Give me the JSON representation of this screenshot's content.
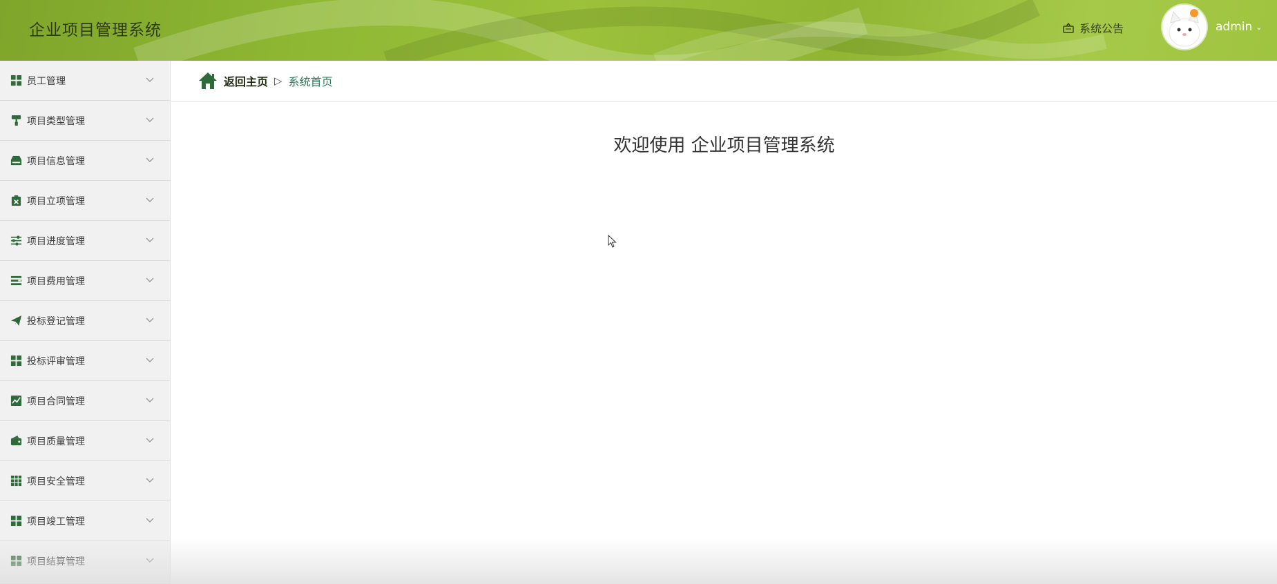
{
  "header": {
    "app_title": "企业项目管理系统",
    "notice_label": "系统公告",
    "notice_icon": "bell-notice-icon",
    "username": "admin",
    "user_chevron": "chevron-down-icon",
    "avatar_icon": "cat-avatar",
    "theme_color": "#8fb834"
  },
  "sidebar": {
    "items": [
      {
        "label": "员工管理",
        "icon": "grid-icon"
      },
      {
        "label": "项目类型管理",
        "icon": "paint-roller-icon"
      },
      {
        "label": "项目信息管理",
        "icon": "inbox-icon"
      },
      {
        "label": "项目立项管理",
        "icon": "clipboard-x-icon"
      },
      {
        "label": "项目进度管理",
        "icon": "sliders-icon"
      },
      {
        "label": "项目费用管理",
        "icon": "list-icon"
      },
      {
        "label": "投标登记管理",
        "icon": "paper-plane-icon"
      },
      {
        "label": "投标评审管理",
        "icon": "grid-icon"
      },
      {
        "label": "项目合同管理",
        "icon": "line-chart-icon"
      },
      {
        "label": "项目质量管理",
        "icon": "wallet-icon"
      },
      {
        "label": "项目安全管理",
        "icon": "grid-nine-icon"
      },
      {
        "label": "项目竣工管理",
        "icon": "grid-icon"
      },
      {
        "label": "项目结算管理",
        "icon": "grid-icon"
      }
    ],
    "icon_color": "#2f6b3a"
  },
  "breadcrumb": {
    "home_label": "返回主页",
    "separator": "▷",
    "current_label": "系统首页",
    "home_icon": "home-icon"
  },
  "main": {
    "welcome_text": "欢迎使用 企业项目管理系统"
  }
}
